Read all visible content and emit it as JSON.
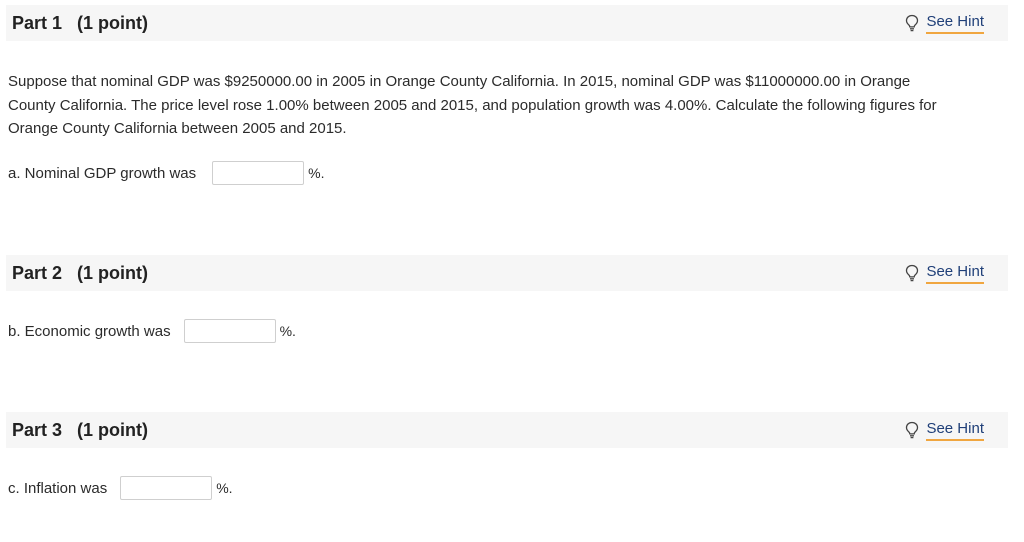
{
  "parts": [
    {
      "title": "Part 1   (1 point)",
      "hint_label": "See Hint",
      "question": "Suppose that nominal GDP was $9250000.00 in 2005 in Orange County California. In 2015, nominal GDP was $11000000.00 in Orange County California. The price level rose 1.00% between 2005 and 2015, and population growth was 4.00%. Calculate the following figures for Orange County California between 2005 and 2015.",
      "answer_label": "a. Nominal GDP growth was",
      "answer_value": "",
      "unit": "%."
    },
    {
      "title": "Part 2   (1 point)",
      "hint_label": "See Hint",
      "answer_label": "b. Economic growth was",
      "answer_value": "",
      "unit": "%."
    },
    {
      "title": "Part 3   (1 point)",
      "hint_label": "See Hint",
      "answer_label": "c. Inflation was",
      "answer_value": "",
      "unit": "%."
    }
  ],
  "colors": {
    "header_bg": "#f6f6f6",
    "link": "#1f3f78",
    "link_underline": "#f0a640"
  },
  "icons": {
    "hint": "lightbulb-icon"
  }
}
